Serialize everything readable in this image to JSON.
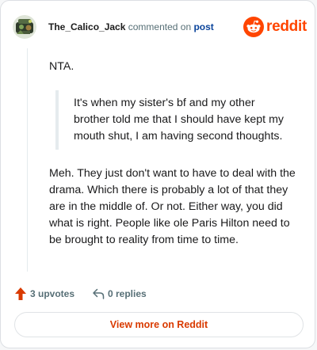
{
  "header": {
    "username": "The_Calico_Jack",
    "commented_on": "commented on",
    "post_link": "post",
    "logo_text": "reddit"
  },
  "comment": {
    "intro": "NTA.",
    "quote": "It's when my sister's bf and my other brother told me that I should have kept my mouth shut, I am having second thoughts.",
    "paragraph": "Meh. They just don't want to have to deal with the drama. Which there is probably a lot of that they are in the middle of. Or not. Either way, you did what is right. People like ole Paris Hilton need to be brought to reality from time to time."
  },
  "actions": {
    "upvotes": "3 upvotes",
    "replies": "0 replies"
  },
  "footer": {
    "view_more": "View more on Reddit"
  },
  "colors": {
    "accent": "#ff4500",
    "link": "#0a449b",
    "button_text": "#d93a00"
  }
}
